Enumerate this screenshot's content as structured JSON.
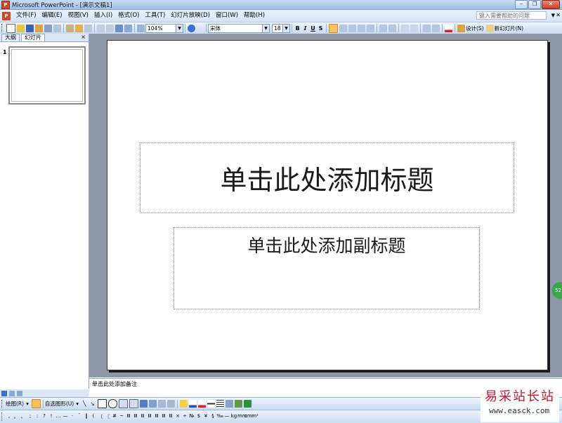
{
  "window": {
    "title": "Microsoft PowerPoint - [演示文稿1]",
    "app_icon": "powerpoint-icon",
    "controls": [
      "minimize",
      "restore",
      "close"
    ]
  },
  "menu": {
    "items": [
      "文件(F)",
      "编辑(E)",
      "视图(V)",
      "插入(I)",
      "格式(O)",
      "工具(T)",
      "幻灯片放映(D)",
      "窗口(W)",
      "帮助(H)"
    ],
    "help_placeholder": "键入需要帮助的问题"
  },
  "toolbar": {
    "zoom": "104%",
    "font_name": "宋体",
    "font_size": "18",
    "bold": "B",
    "italic": "I",
    "underline": "U",
    "shadow": "S",
    "design_label": "设计(S)",
    "new_slide_label": "新幻灯片(N)"
  },
  "left_panel": {
    "tabs": [
      "大纲",
      "幻灯片"
    ],
    "close": "×",
    "active_tab": 1,
    "slides": [
      {
        "number": "1"
      }
    ]
  },
  "slide": {
    "title_placeholder": "单击此处添加标题",
    "subtitle_placeholder": "单击此处添加副标题"
  },
  "notes": {
    "placeholder": "单击此处添加备注"
  },
  "drawing_toolbar": {
    "draw_label": "绘图(R)",
    "autoshapes_label": "自选图形(U)"
  },
  "symbols": [
    ",",
    "。",
    "、",
    ";",
    ":",
    "?",
    "!",
    "…",
    "—",
    "·",
    "ˉ",
    "‖",
    "(",
    "〔",
    "〖",
    "#",
    "~",
    "Ⅲ",
    "Ⅲ",
    "Ⅲ",
    "Ⅲ",
    "Ⅲ",
    "Ⅲ",
    "Ⅲ",
    "×",
    "÷",
    "№",
    "$",
    "¥",
    "§",
    "‰",
    "—",
    "kg",
    "mm",
    "cm",
    "m²"
  ],
  "watermark": {
    "name": "易采站长站",
    "url": "www.easck.com"
  },
  "side_badge": "52",
  "colors": {
    "accent": "#316ac5",
    "toolbar": "#c9dbf2",
    "workspace": "#8c98a8"
  }
}
